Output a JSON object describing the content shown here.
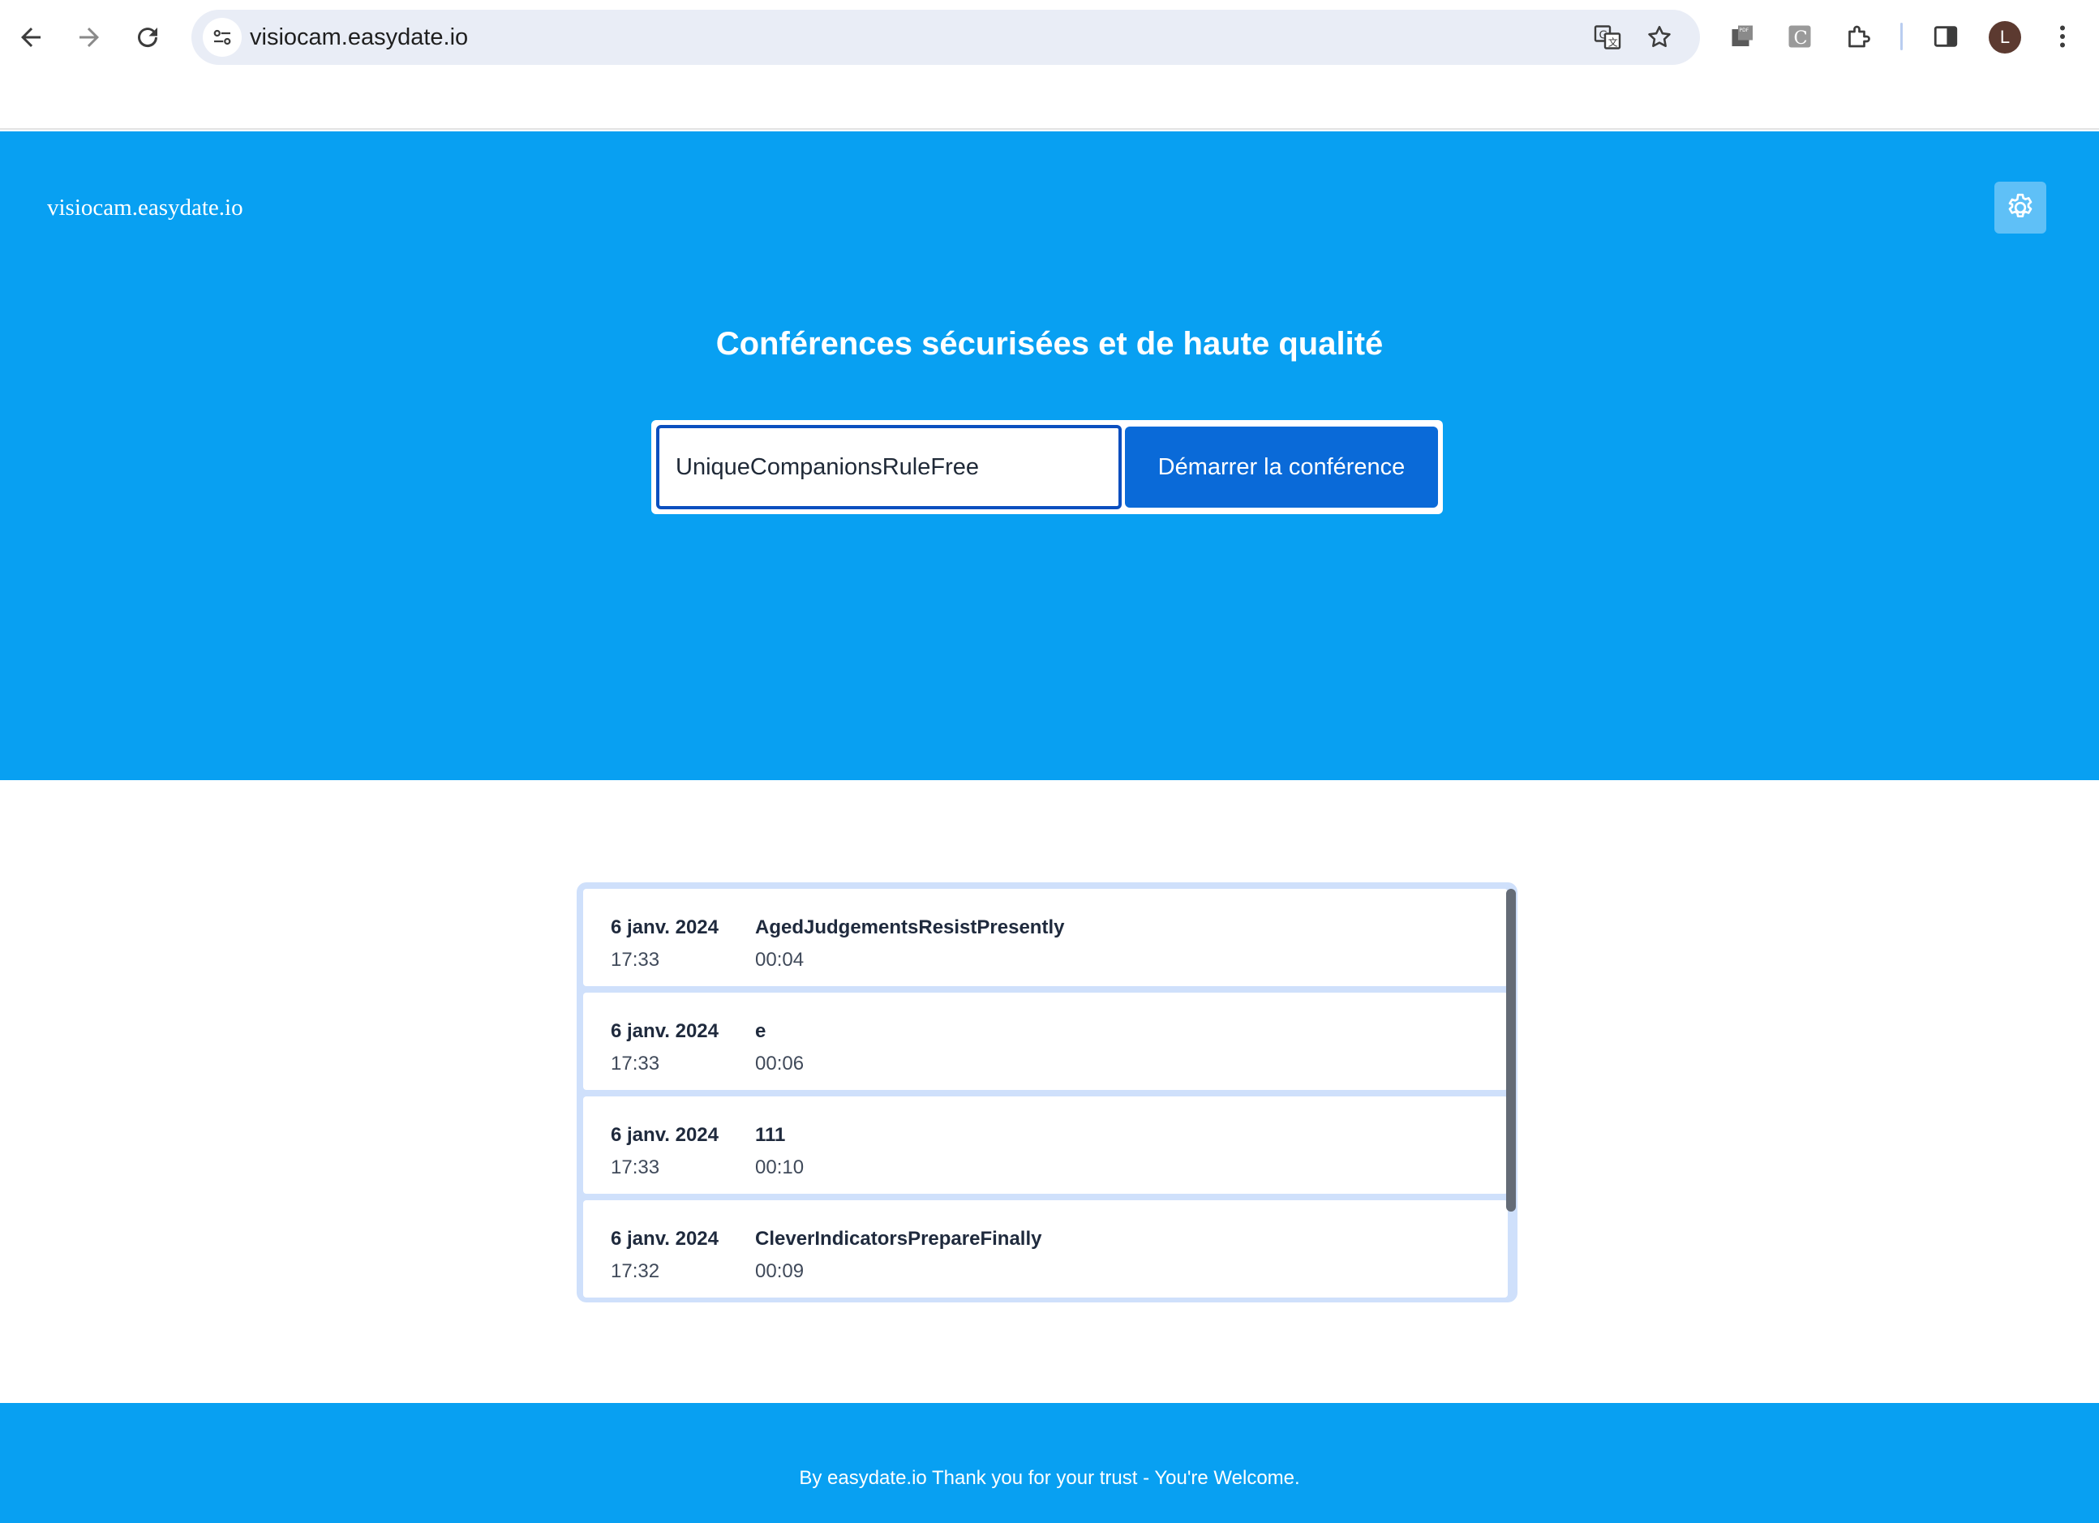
{
  "browser": {
    "url": "visiocam.easydate.io",
    "profile_initial": "L"
  },
  "header": {
    "logo": "visiocam.easydate.io"
  },
  "hero": {
    "title": "Conférences sécurisées et de haute qualité",
    "room_input_value": "UniqueCompanionsRuleFree",
    "start_button": "Démarrer la conférence"
  },
  "history": [
    {
      "date": "6 janv. 2024",
      "time": "17:33",
      "name": "AgedJudgementsResistPresently",
      "duration": "00:04"
    },
    {
      "date": "6 janv. 2024",
      "time": "17:33",
      "name": "e",
      "duration": "00:06"
    },
    {
      "date": "6 janv. 2024",
      "time": "17:33",
      "name": "111",
      "duration": "00:10"
    },
    {
      "date": "6 janv. 2024",
      "time": "17:32",
      "name": "CleverIndicatorsPrepareFinally",
      "duration": "00:09"
    }
  ],
  "footer": {
    "text": "By easydate.io Thank you for your trust - You're Welcome."
  },
  "colors": {
    "brand": "#08a0f2",
    "button": "#0a6ad8"
  }
}
